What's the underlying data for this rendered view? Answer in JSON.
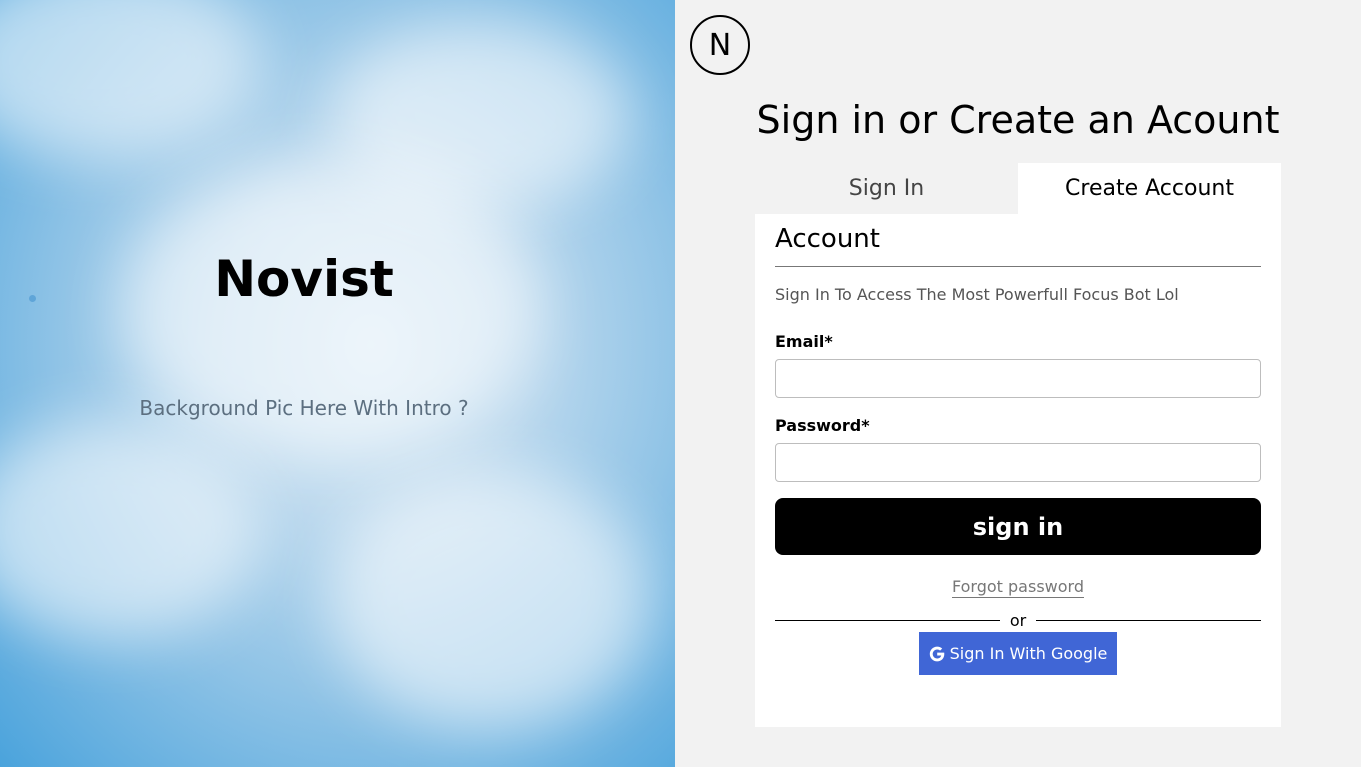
{
  "hero": {
    "title": "Novist",
    "subtitle": "Background Pic Here With Intro ?"
  },
  "logo": {
    "letter": "N"
  },
  "auth": {
    "title": "Sign in or Create an Acount",
    "tabs": [
      {
        "label": "Sign In",
        "active": false
      },
      {
        "label": "Create Account",
        "active": true
      }
    ],
    "card": {
      "heading": "Account",
      "description": "Sign In To Access The Most Powerfull Focus Bot Lol",
      "email_label": "Email*",
      "email_value": "",
      "password_label": "Password*",
      "password_value": "",
      "signin_label": "sign in",
      "forgot_label": "Forgot password",
      "divider_text": "or",
      "google_label": "Sign In With Google"
    }
  },
  "colors": {
    "sky": "#8fc3e6",
    "panel_bg": "#f2f2f2",
    "primary_button": "#000000",
    "google_button": "#4066d6"
  },
  "icons": {
    "google": "google-icon"
  }
}
